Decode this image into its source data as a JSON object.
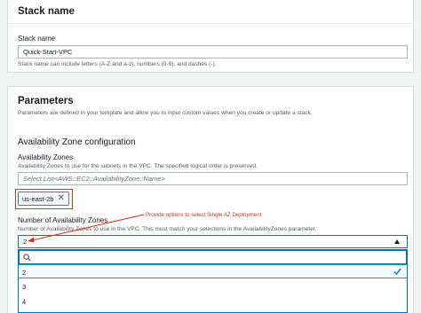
{
  "stack_name_section": {
    "title": "Stack name",
    "field_label": "Stack name",
    "field_value": "Quick-Start-VPC",
    "hint": "Stack name can include letters (A-Z and a-z), numbers (0-9), and dashes (-)."
  },
  "parameters_section": {
    "title": "Parameters",
    "description": "Parameters are defined in your template and allow you to input custom values when you create or update a stack.",
    "az_config_heading": "Availability Zone configuration",
    "az_label": "Availability Zones",
    "az_hint": "Availability Zones to use for the subnets in the VPC. The specified logical order is preserved.",
    "az_placeholder": "Select List<AWS::EC2::AvailabilityZone::Name>",
    "az_token": "us-east-2b",
    "num_az_label": "Number of Availability Zones",
    "num_az_hint": "Number of Availability Zones to use in the VPC. This must match your selections in the AvailabilityZones parameter.",
    "num_az_value": "2",
    "options": [
      "2",
      "3",
      "4"
    ],
    "selected_option": "2"
  },
  "annotation": {
    "text": "Provide options to select Single AZ Deployment",
    "color": "#d13212"
  },
  "colors": {
    "accent": "#0073bb",
    "annotation_red": "#d13212"
  }
}
